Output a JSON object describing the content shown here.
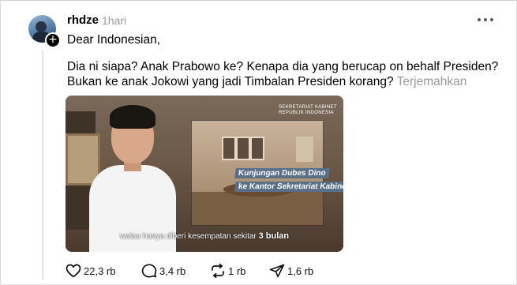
{
  "post": {
    "username": "rhdze",
    "time": "1hari",
    "lines": [
      "Dear Indonesian,",
      "Dia ni siapa? Anak Prabowo ke? Kenapa dia yang berucap on behalf Presiden?",
      "Bukan ke anak Jokowi yang jadi Timbalan Presiden korang?"
    ],
    "translate_label": "Terjemahkan"
  },
  "media": {
    "logo_line1": "SEKRETARIAT KABINET",
    "logo_line2": "REPUBLIK INDONESIA",
    "caption_line1": "Kunjungan Dubes Dino",
    "caption_line2": "ke Kantor Sekretariat Kabinet",
    "subtitle_text": "walau hanya diberi kesempatan sekitar",
    "subtitle_bold": "3 bulan"
  },
  "actions": {
    "like_count": "22,3 rb",
    "comment_count": "3,4 rb",
    "repost_count": "1 rb",
    "share_count": "1,6 rb"
  },
  "icons": [
    "heart-icon",
    "comment-icon",
    "repost-icon",
    "share-icon",
    "more-icon",
    "follow-plus-icon"
  ]
}
